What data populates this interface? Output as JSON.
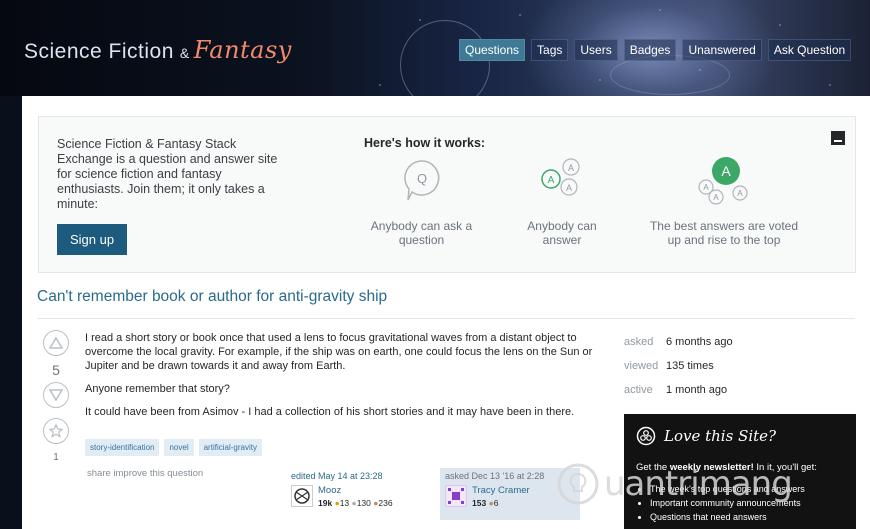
{
  "site": {
    "logo_main": "Science Fiction",
    "logo_amp": "&",
    "logo_script": "Fantasy"
  },
  "nav": {
    "items": [
      "Questions",
      "Tags",
      "Users",
      "Badges",
      "Unanswered",
      "Ask Question"
    ],
    "active_index": 0
  },
  "hero": {
    "description": "Science Fiction & Fantasy Stack Exchange is a question and answer site for science fiction and fantasy enthusiasts. Join them; it only takes a minute:",
    "signup_label": "Sign up",
    "how_title": "Here's how it works:",
    "steps": [
      {
        "text": "Anybody can ask a question",
        "icon": "question-bubble-icon"
      },
      {
        "text": "Anybody can answer",
        "icon": "answer-bubbles-icon"
      },
      {
        "text": "The best answers are voted up and rise to the top",
        "icon": "best-answer-icon"
      }
    ]
  },
  "question": {
    "title": "Can't remember book or author for anti-gravity ship",
    "votes": "5",
    "favorites": "1",
    "body": [
      "I read a short story or book once that used a lens to focus gravitational waves from a distant object to overcome the local gravity. For example, if the ship was on earth, one could focus the lens on the Sun or Jupiter and be drawn towards it and away from Earth.",
      "Anyone remember that story?",
      "It could have been from Asimov - I had a collection of his short stories and it may have been in there."
    ],
    "tags": [
      "story-identification",
      "novel",
      "artificial-gravity"
    ],
    "menu": {
      "share": "share",
      "improve": "improve this question"
    },
    "editor": {
      "label": "edited May 14 at 23:28",
      "name": "Mooz",
      "rep": "19k",
      "gold": "13",
      "silver": "130",
      "bronze": "236"
    },
    "owner": {
      "label": "asked Dec 13 '16 at 2:28",
      "name": "Tracy Cramer",
      "rep": "153",
      "bronze": "6"
    }
  },
  "meta": {
    "asked_label": "asked",
    "asked_value": "6 months ago",
    "viewed_label": "viewed",
    "viewed_value": "135 times",
    "active_label": "active",
    "active_value": "1 month ago"
  },
  "love": {
    "title": "Love this Site?",
    "sub_prefix": "Get the ",
    "sub_bold": "weekly newsletter!",
    "sub_suffix": " In it, you'll get:",
    "items": [
      "The week's top questions and answers",
      "Important community announcements",
      "Questions that need answers"
    ]
  },
  "watermark": {
    "text": "uantrimang"
  },
  "colors": {
    "link": "#2a6b8c",
    "signup_bg": "#1d5b7e",
    "accent_green": "#3ca766"
  }
}
